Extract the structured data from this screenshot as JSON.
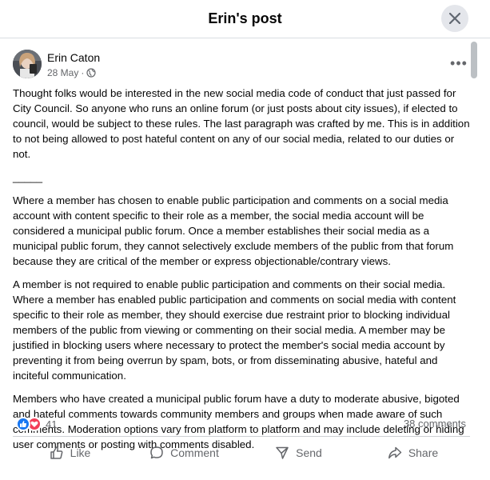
{
  "header": {
    "title": "Erin's post"
  },
  "post": {
    "author": "Erin Caton",
    "date": "28 May",
    "paragraphs": [
      "Thought folks would be interested in the new social media code of conduct that just passed for City Council. So anyone who runs an online forum (or just posts about city issues), if elected to council, would be subject to these rules. The last paragraph was crafted by me. This is in addition to not being allowed to post hateful content on any of our social media, related to our duties or not.",
      "Where a member has chosen to enable public participation and comments on a social media account with content specific to their role as a member, the social media account will be considered a municipal public forum. Once a member establishes their social media as a municipal public forum, they cannot selectively exclude members of the public from that forum because they are critical of the member or express objectionable/contrary views.",
      "A member is not required to enable public participation and comments on their social media. Where a member has enabled public participation and comments on social media with content specific to their role as member, they should exercise due restraint prior to blocking individual members of the public from viewing or commenting on their social media. A member may be justified in blocking users where necessary to protect the member's social media account by preventing it from being overrun by spam, bots, or from disseminating abusive, hateful and inciteful communication.",
      "Members who have created a municipal public forum have a duty to moderate abusive, bigoted and hateful comments towards community members and groups when made aware of such comments. Moderation options vary from platform to platform and may include deleting or hiding user comments or posting with comments disabled."
    ],
    "divider": "_____",
    "reactions_count": "41",
    "comments_count": "38 comments"
  },
  "actions": {
    "like": "Like",
    "comment": "Comment",
    "send": "Send",
    "share": "Share"
  },
  "colors": {
    "like_blue": "#1877f2",
    "love_red": "#f33e58",
    "secondary_text": "#65676b"
  }
}
